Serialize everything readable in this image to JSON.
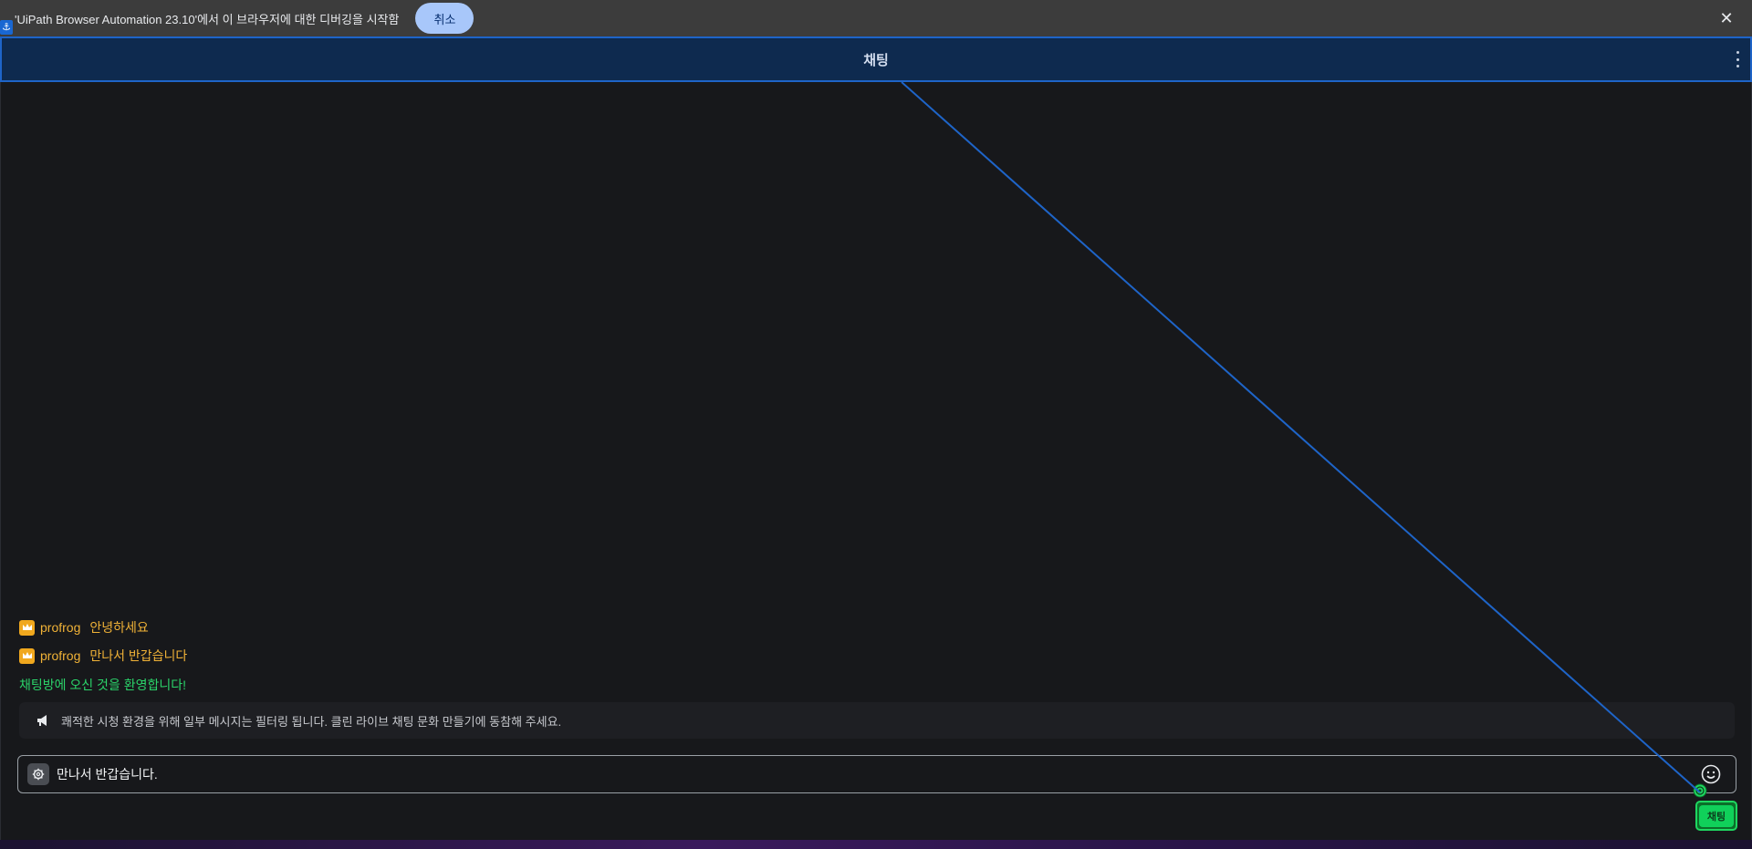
{
  "infobar": {
    "message": "'UiPath Browser Automation 23.10'에서 이 브라우저에 대한 디버깅을 시작함",
    "cancel_label": "취소",
    "close_glyph": "✕"
  },
  "anchor_glyph": "⚓",
  "header": {
    "title": "채팅"
  },
  "messages": [
    {
      "user": "profrog",
      "text": "안녕하세요"
    },
    {
      "user": "profrog",
      "text": "만나서 반갑습니다"
    }
  ],
  "welcome": "채팅방에 오신 것을 환영합니다!",
  "notice": "쾌적한 시청 환경을 위해 일부 메시지는 필터링 됩니다. 클린 라이브 채팅 문화 만들기에 동참해 주세요.",
  "input": {
    "value": "만나서 반갑습니다."
  },
  "send": {
    "label": "채팅"
  },
  "colors": {
    "header_bg": "#0e2a4f",
    "accent_blue": "#1e64c8",
    "user_color": "#f0b237",
    "welcome_color": "#2bd46a",
    "send_green": "#10d05a"
  },
  "icons": [
    "anchor-icon",
    "close-icon",
    "kebab-menu-icon",
    "crown-icon",
    "megaphone-icon",
    "settings-icon",
    "emoji-icon",
    "target-icon"
  ]
}
